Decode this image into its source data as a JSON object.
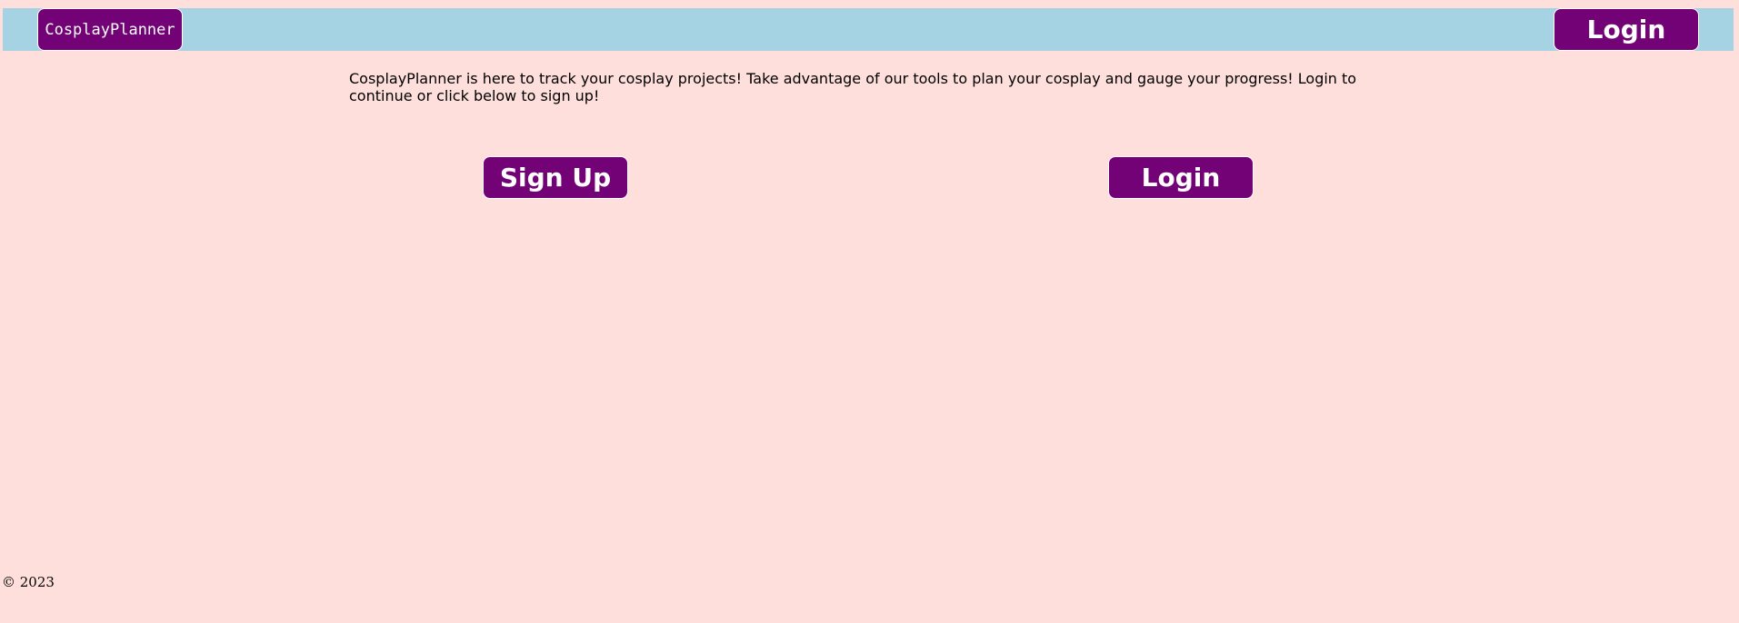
{
  "navbar": {
    "brand_label": "CosplayPlanner",
    "login_label": "Login"
  },
  "main": {
    "intro_text": "CosplayPlanner is here to track your cosplay projects! Take advantage of our tools to plan your cosplay and gauge your progress! Login to continue or click below to sign up!",
    "signup_label": "Sign Up",
    "login_label": "Login"
  },
  "footer": {
    "copyright": "© 2023"
  },
  "colors": {
    "page_background": "#ffdfdc",
    "navbar_background": "#a6d3e3",
    "button_background": "#730276",
    "button_text": "#ffffff"
  }
}
